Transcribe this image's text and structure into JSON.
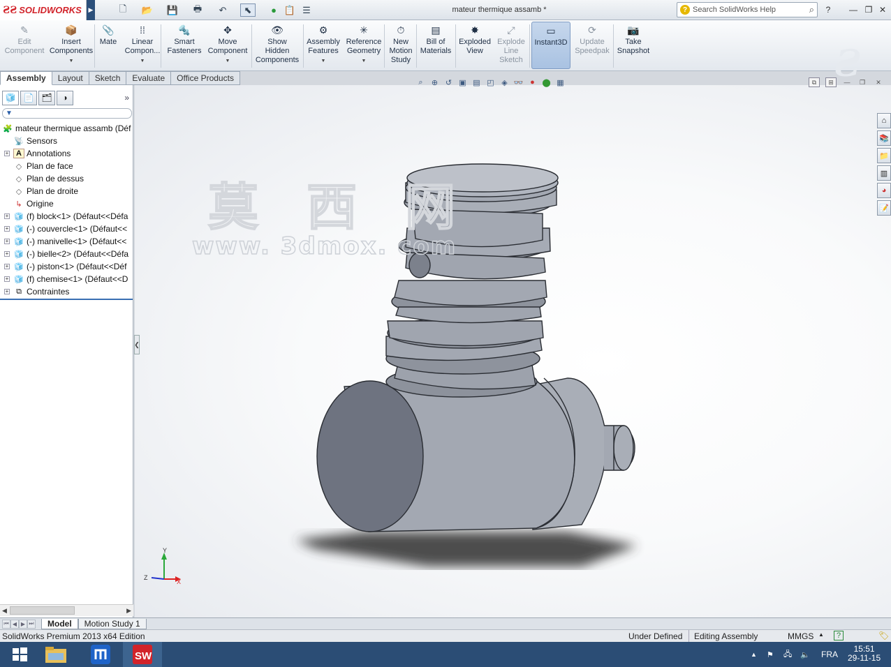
{
  "app": {
    "brand": "SOLIDWORKS",
    "window_title": "mateur thermique assamb *",
    "search_placeholder": "Search SolidWorks Help"
  },
  "commands": [
    {
      "id": "edit-component",
      "label": "Edit\nComponent",
      "icon": "edit-component-icon",
      "enabled": false
    },
    {
      "id": "insert-components",
      "label": "Insert\nComponents",
      "icon": "insert-components-icon",
      "enabled": true
    },
    {
      "id": "mate",
      "label": "Mate",
      "icon": "mate-icon",
      "enabled": true
    },
    {
      "id": "linear-component-pattern",
      "label": "Linear\nCompon...",
      "icon": "linear-pattern-icon",
      "enabled": true
    },
    {
      "id": "smart-fasteners",
      "label": "Smart\nFasteners",
      "icon": "smart-fasteners-icon",
      "enabled": true
    },
    {
      "id": "move-component",
      "label": "Move\nComponent",
      "icon": "move-component-icon",
      "enabled": true
    },
    {
      "id": "show-hidden-components",
      "label": "Show\nHidden\nComponents",
      "icon": "show-hidden-icon",
      "enabled": true
    },
    {
      "id": "assembly-features",
      "label": "Assembly\nFeatures",
      "icon": "assembly-features-icon",
      "enabled": true
    },
    {
      "id": "reference-geometry",
      "label": "Reference\nGeometry",
      "icon": "reference-geometry-icon",
      "enabled": true
    },
    {
      "id": "new-motion-study",
      "label": "New\nMotion\nStudy",
      "icon": "motion-study-icon",
      "enabled": true
    },
    {
      "id": "bill-of-materials",
      "label": "Bill of\nMaterials",
      "icon": "bom-icon",
      "enabled": true
    },
    {
      "id": "exploded-view",
      "label": "Exploded\nView",
      "icon": "exploded-view-icon",
      "enabled": true
    },
    {
      "id": "explode-line-sketch",
      "label": "Explode\nLine\nSketch",
      "icon": "explode-line-icon",
      "enabled": false
    },
    {
      "id": "instant3d",
      "label": "Instant3D",
      "icon": "instant3d-icon",
      "enabled": true,
      "active": true
    },
    {
      "id": "update-speedpak",
      "label": "Update\nSpeedpak",
      "icon": "speedpak-icon",
      "enabled": false
    },
    {
      "id": "take-snapshot",
      "label": "Take\nSnapshot",
      "icon": "snapshot-icon",
      "enabled": true
    }
  ],
  "tabs": [
    "Assembly",
    "Layout",
    "Sketch",
    "Evaluate",
    "Office Products"
  ],
  "active_tab": "Assembly",
  "tree": {
    "root": "mateur thermique assamb  (Déf",
    "items": [
      {
        "label": "Sensors",
        "icon": "sensors-icon",
        "expandable": false
      },
      {
        "label": "Annotations",
        "icon": "annotations-icon",
        "expandable": true
      },
      {
        "label": "Plan de face",
        "icon": "plane-icon",
        "expandable": false
      },
      {
        "label": "Plan de dessus",
        "icon": "plane-icon",
        "expandable": false
      },
      {
        "label": "Plan de droite",
        "icon": "plane-icon",
        "expandable": false
      },
      {
        "label": "Origine",
        "icon": "origin-icon",
        "expandable": false
      },
      {
        "label": "(f) block<1> (Défaut<<Défa",
        "icon": "part-icon",
        "expandable": true
      },
      {
        "label": "(-) couvercle<1> (Défaut<<",
        "icon": "part-icon",
        "expandable": true
      },
      {
        "label": "(-) manivelle<1> (Défaut<<",
        "icon": "part-icon",
        "expandable": true
      },
      {
        "label": "(-) bielle<2> (Défaut<<Défa",
        "icon": "part-icon",
        "expandable": true
      },
      {
        "label": "(-) piston<1> (Défaut<<Déf",
        "icon": "part-icon",
        "expandable": true
      },
      {
        "label": "(f) chemise<1> (Défaut<<D",
        "icon": "part-icon",
        "expandable": true
      },
      {
        "label": "Contraintes",
        "icon": "mates-icon",
        "expandable": true
      }
    ]
  },
  "watermark": {
    "cn": "莫 西 网",
    "url": "www. 3dmox. com"
  },
  "triad": {
    "x": "X",
    "y": "Y",
    "z": "Z"
  },
  "bottom_tabs": [
    "Model",
    "Motion Study 1"
  ],
  "status": {
    "edition": "SolidWorks Premium 2013 x64 Edition",
    "state": "Under Defined",
    "mode": "Editing Assembly",
    "units": "MMGS",
    "help": "?"
  },
  "taskbar": {
    "language": "FRA",
    "time": "15:51",
    "date": "29-11-15"
  },
  "colors": {
    "brand_red": "#d2232a",
    "model_gray": "#9aa0ab",
    "taskbar": "#2b4d75"
  }
}
